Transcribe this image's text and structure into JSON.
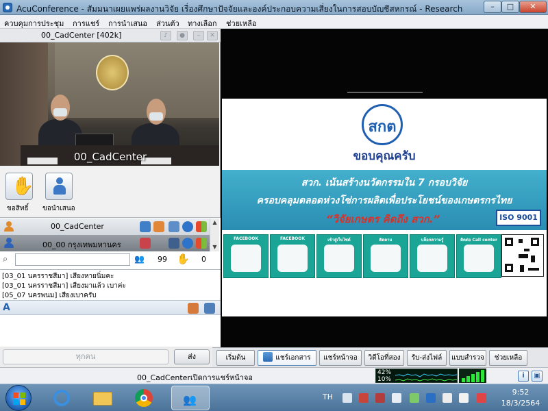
{
  "window": {
    "title": "AcuConference - สัมมนาเผยแพร่ผลงานวิจัย เรื่องศึกษาปัจจัยและองค์ประกอบความเสี่ยงในการสอบบัญชีสหกรณ์ - Research",
    "minimize": "–",
    "maximize": "□",
    "close": "✕"
  },
  "menu": {
    "items": [
      {
        "label": "ควบคุมการประชุม"
      },
      {
        "label": "การแชร์"
      },
      {
        "label": "การนำเสนอ"
      },
      {
        "label": "ส่วนตัว"
      },
      {
        "label": "ทางเลือก"
      },
      {
        "label": "ช่วยเหลือ"
      }
    ]
  },
  "video": {
    "title": "00_CadCenter [402k]",
    "overlay_label": "00_CadCenter"
  },
  "actions": {
    "raise_hand_label": "ขอสิทธิ์",
    "present_label": "ขอนำเสนอ"
  },
  "participants": {
    "rows": [
      {
        "name": "00_CadCenter",
        "icon_color": "#e08a2e"
      },
      {
        "name": "00_00 กรุงเทพมหานคร",
        "icon_color": "#2d62b8"
      }
    ],
    "count_people": "99",
    "count_hands": "0",
    "search_placeholder": ""
  },
  "chat": {
    "lines": [
      "[03_01 นครราชสีมา] เสียงหายนิ่มคะ",
      "[03_01 นครราชสีมา] เสียงมาแล้ว เบาค่ะ",
      "[05_07 นครพนม] เสียงเบาครับ"
    ],
    "recipient": "ทุกคน",
    "send_label": "ส่ง"
  },
  "slide": {
    "logo_text": "สกต",
    "thanks": "ขอบคุณครับ",
    "line1": "สวก. เน้นสร้างนวัตกรรมใน 7 กรอบวิจัย",
    "line2": "ครอบคลุมตลอดห่วงโซ่การผลิตเพื่อประโยชน์ของเกษตรกรไทย",
    "line3": "“วิจัยเกษตร คิดถึง สวก.”",
    "iso": "ISO 9001",
    "tiles": [
      {
        "label": "FACEBOOK"
      },
      {
        "label": "FACEBOOK"
      },
      {
        "label": "เข้าสู่เว็บไซต์"
      },
      {
        "label": "ติดตาม"
      },
      {
        "label": "บล็อกความรู้"
      },
      {
        "label": "ติดต่อ Call center"
      }
    ]
  },
  "tabs": [
    {
      "label": "เริ่มต้น"
    },
    {
      "label": "แชร์เอกสาร"
    },
    {
      "label": "แชร์หน้าจอ"
    },
    {
      "label": "วิดีโอที่สอง"
    },
    {
      "label": "รับ-ส่งไฟล์"
    },
    {
      "label": "แบบสำรวจ"
    },
    {
      "label": "ช่วยเหลือ"
    }
  ],
  "status": {
    "message": "00_CadCenterเปิดการแชร์หน้าจอ",
    "meter_top": "42%",
    "meter_bottom": "10%"
  },
  "taskbar": {
    "language": "TH",
    "time": "9:52",
    "date": "18/3/2564"
  }
}
